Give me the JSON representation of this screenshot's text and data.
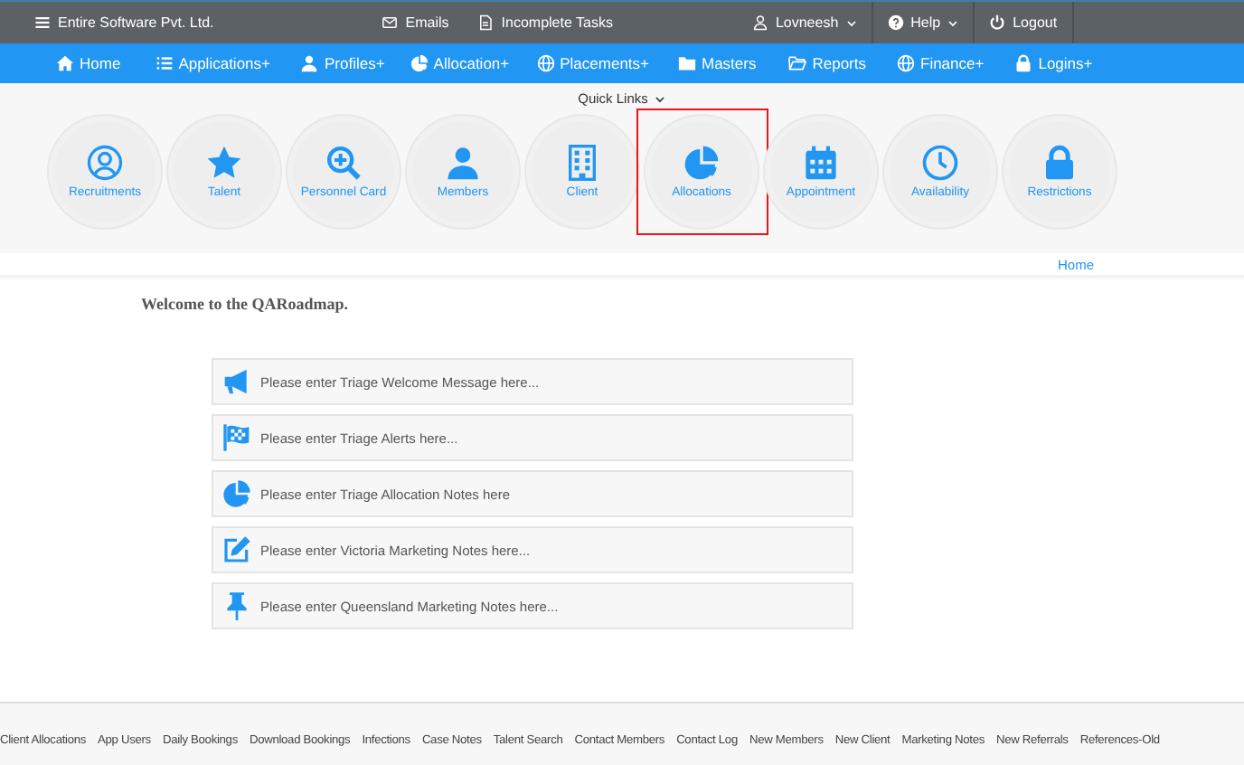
{
  "top_bar": {
    "brand": "Entire Software Pvt. Ltd.",
    "links": [
      "Emails",
      "Incomplete Tasks"
    ],
    "user_menu": "Lovneesh",
    "help_menu": "Help",
    "logout": "Logout"
  },
  "nav": [
    "Home",
    "Applications+",
    "Profiles+",
    "Allocation+",
    "Placements+",
    "Masters",
    "Reports",
    "Finance+",
    "Logins+"
  ],
  "quick_links": {
    "toggle": "Quick Links",
    "items": [
      {
        "label": "Recruitments",
        "highlighted": false
      },
      {
        "label": "Talent",
        "highlighted": false
      },
      {
        "label": "Personnel Card",
        "highlighted": false
      },
      {
        "label": "Members",
        "highlighted": false
      },
      {
        "label": "Client",
        "highlighted": false
      },
      {
        "label": "Allocations",
        "highlighted": true
      },
      {
        "label": "Appointment",
        "highlighted": false
      },
      {
        "label": "Availability",
        "highlighted": false
      },
      {
        "label": "Restrictions",
        "highlighted": false
      }
    ]
  },
  "breadcrumb": "Home",
  "welcome": "Welcome to the QARoadmap.",
  "notes": [
    "Please enter Triage Welcome Message here...",
    "Please enter Triage Alerts here...",
    "Please enter Triage Allocation Notes here",
    "Please enter Victoria Marketing Notes here...",
    "Please enter Queensland Marketing Notes here..."
  ],
  "footer_links": [
    "Client Allocations",
    "App Users",
    "Daily Bookings",
    "Download Bookings",
    "Infections",
    "Case Notes",
    "Talent Search",
    "Contact Members",
    "Contact Log",
    "New Members",
    "New Client",
    "Marketing Notes",
    "New Referrals",
    "References-Old"
  ]
}
